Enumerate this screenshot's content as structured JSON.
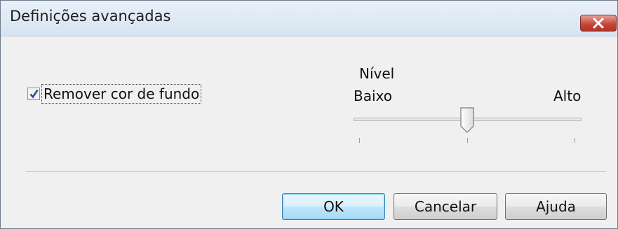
{
  "window": {
    "title": "Definições avançadas",
    "close_icon": "close-icon"
  },
  "options": {
    "remove_background": {
      "label": "Remover cor de fundo",
      "checked": true
    }
  },
  "level": {
    "label": "Nível",
    "min_label": "Baixo",
    "max_label": "Alto",
    "slider_value_fraction": 0.5,
    "tick_count": 3
  },
  "buttons": {
    "ok": "OK",
    "cancel": "Cancelar",
    "help": "Ajuda"
  },
  "colors": {
    "close_button": "#c7483b",
    "default_button_border": "#3c7fb1"
  }
}
